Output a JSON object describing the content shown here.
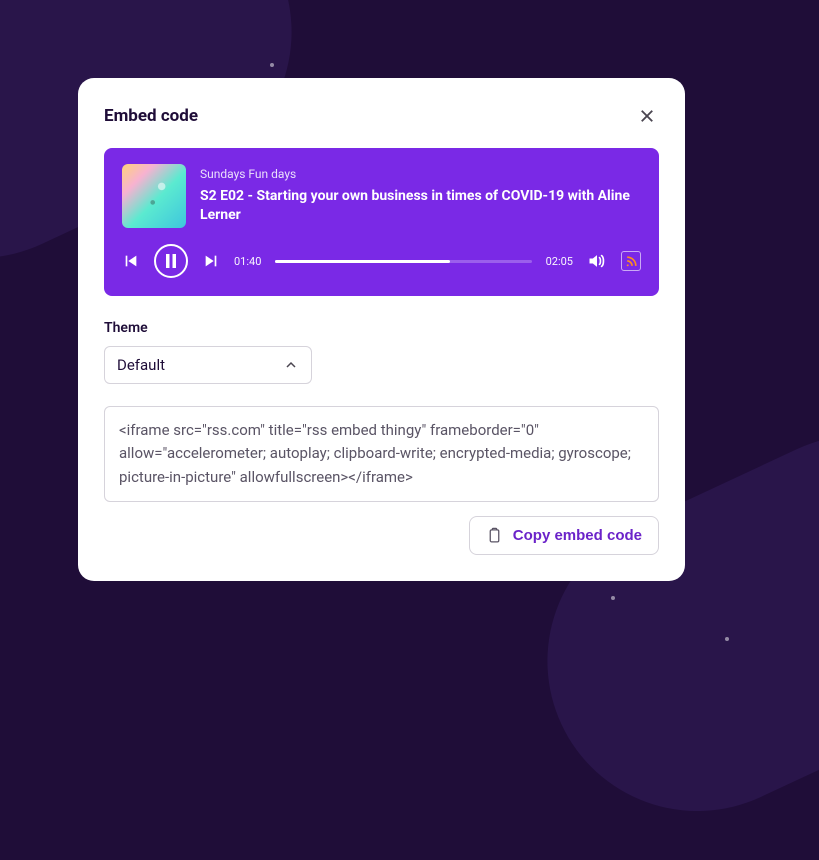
{
  "modal": {
    "title": "Embed code"
  },
  "player": {
    "show_name": "Sundays Fun days",
    "episode_title": "S2 E02 - Starting your own business in times of COVID-19 with Aline Lerner",
    "current_time": "01:40",
    "total_time": "02:05",
    "progress_percent": 68
  },
  "theme": {
    "label": "Theme",
    "selected": "Default"
  },
  "embed_code": "<iframe src=\"rss.com\" title=\"rss embed thingy\" frameborder=\"0\" allow=\"accelerometer; autoplay; clipboard-write; encrypted-media; gyroscope; picture-in-picture\" allowfullscreen></iframe>",
  "actions": {
    "copy_label": "Copy embed code"
  },
  "colors": {
    "background": "#1f0d38",
    "player_bg": "#7a29e6",
    "accent": "#6b23c9",
    "rss_icon": "#ff8e1f"
  }
}
